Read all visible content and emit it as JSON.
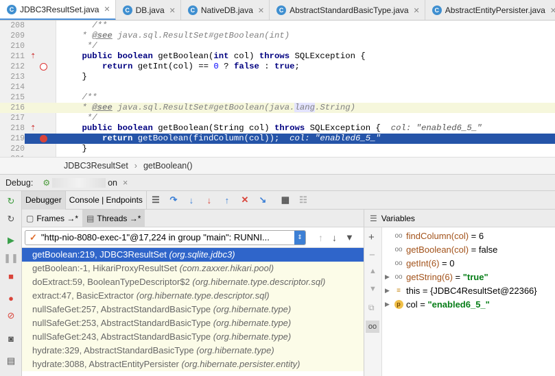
{
  "tabs": [
    {
      "label": "JDBC3ResultSet.java",
      "active": true
    },
    {
      "label": "DB.java",
      "active": false
    },
    {
      "label": "NativeDB.java",
      "active": false
    },
    {
      "label": "AbstractStandardBasicType.java",
      "active": false
    },
    {
      "label": "AbstractEntityPersister.java",
      "active": false
    }
  ],
  "editor": {
    "lines": [
      {
        "n": "208",
        "text": "/**"
      },
      {
        "n": "209",
        "text": " * @see java.sql.ResultSet#getBoolean(int)"
      },
      {
        "n": "210",
        "text": " */"
      },
      {
        "n": "211",
        "text": "public boolean getBoolean(int col) throws SQLException {"
      },
      {
        "n": "212",
        "text": "    return getInt(col) == 0 ? false : true;"
      },
      {
        "n": "213",
        "text": "}"
      },
      {
        "n": "214",
        "text": ""
      },
      {
        "n": "215",
        "text": "/**"
      },
      {
        "n": "216",
        "text": " * @see java.sql.ResultSet#getBoolean(java.lang.String)"
      },
      {
        "n": "217",
        "text": " */"
      },
      {
        "n": "218",
        "text": "public boolean getBoolean(String col) throws SQLException {"
      },
      {
        "n": "219",
        "text": "    return getBoolean(findColumn(col));"
      },
      {
        "n": "220",
        "text": "}"
      },
      {
        "n": "221",
        "text": ""
      }
    ],
    "inline_218": "col: \"enabled6_5_\"",
    "inline_219": "col: \"enabled6_5_\""
  },
  "breadcrumb": {
    "class": "JDBC3ResultSet",
    "method": "getBoolean()",
    "sep": "›"
  },
  "debug": {
    "label": "Debug:",
    "session_prefix": "",
    "session_suffix": "on",
    "close": "×"
  },
  "toolbar": {
    "debugger_tab": "Debugger",
    "console_tab": "Console | Endpoints"
  },
  "frames_header": {
    "frames": "Frames →*",
    "threads": "Threads →*"
  },
  "thread_selector": "\"http-nio-8080-exec-1\"@17,224 in group \"main\": RUNNI...",
  "frames": [
    {
      "name": "getBoolean:219, JDBC3ResultSet ",
      "pkg": "(org.sqlite.jdbc3)",
      "selected": true
    },
    {
      "name": "getBoolean:-1, HikariProxyResultSet ",
      "pkg": "(com.zaxxer.hikari.pool)",
      "selected": false
    },
    {
      "name": "doExtract:59, BooleanTypeDescriptor$2 ",
      "pkg": "(org.hibernate.type.descriptor.sql)",
      "selected": false
    },
    {
      "name": "extract:47, BasicExtractor ",
      "pkg": "(org.hibernate.type.descriptor.sql)",
      "selected": false
    },
    {
      "name": "nullSafeGet:257, AbstractStandardBasicType ",
      "pkg": "(org.hibernate.type)",
      "selected": false
    },
    {
      "name": "nullSafeGet:253, AbstractStandardBasicType ",
      "pkg": "(org.hibernate.type)",
      "selected": false
    },
    {
      "name": "nullSafeGet:243, AbstractStandardBasicType ",
      "pkg": "(org.hibernate.type)",
      "selected": false
    },
    {
      "name": "hydrate:329, AbstractStandardBasicType ",
      "pkg": "(org.hibernate.type)",
      "selected": false
    },
    {
      "name": "hydrate:3088, AbstractEntityPersister ",
      "pkg": "(org.hibernate.persister.entity)",
      "selected": false
    }
  ],
  "variables_header": "Variables",
  "variables": [
    {
      "icon": "watch",
      "name": "findColumn(col)",
      "eq": " = ",
      "value": "6",
      "str": false,
      "expand": false
    },
    {
      "icon": "watch",
      "name": "getBoolean(col)",
      "eq": " = ",
      "value": "false",
      "str": false,
      "expand": false
    },
    {
      "icon": "watch",
      "name": "getInt(6)",
      "eq": " = ",
      "value": "0",
      "str": false,
      "expand": false
    },
    {
      "icon": "watch",
      "name": "getString(6)",
      "eq": " = ",
      "value": "\"true\"",
      "str": true,
      "expand": true
    },
    {
      "icon": "field",
      "name": "this",
      "eq": " = ",
      "value": "{JDBC4ResultSet@22366}",
      "str": false,
      "expand": true
    },
    {
      "icon": "param",
      "name": "col",
      "eq": " = ",
      "value": "\"enabled6_5_\"",
      "str": true,
      "expand": true
    }
  ],
  "colors": {
    "accent": "#2f65ca",
    "current_line": "#2554a8",
    "keyword": "#000080",
    "string_value": "#067d17"
  }
}
